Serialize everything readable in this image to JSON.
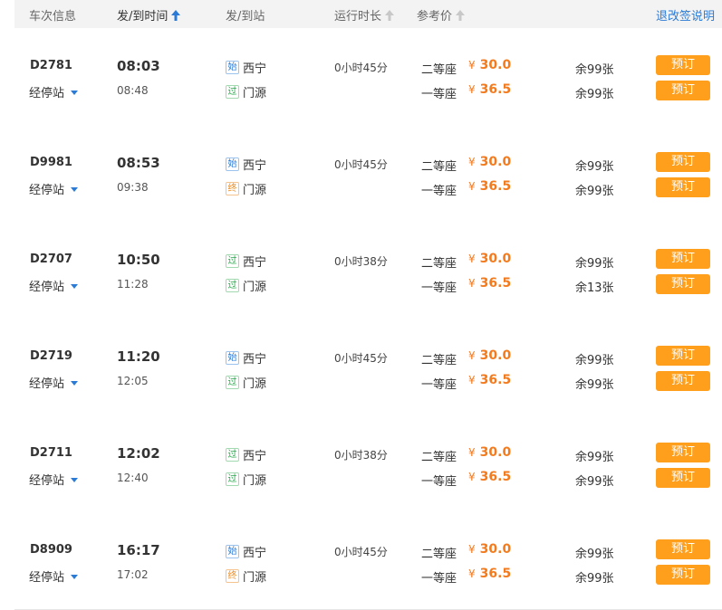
{
  "header": {
    "train_info": "车次信息",
    "dep_arr_time": "发/到时间",
    "dep_arr_station": "发/到站",
    "duration": "运行时长",
    "ref_price": "参考价",
    "rules_link": "退改签说明"
  },
  "colors": {
    "accent_blue": "#2b7bd6",
    "price_orange": "#f37b1d",
    "button_orange": "#ff9f1c"
  },
  "trains": [
    {
      "number": "D2781",
      "stops_label": "经停站",
      "dep_time": "08:03",
      "arr_time": "08:48",
      "from_tag": "始",
      "from_tag_type": "start",
      "from_station": "西宁",
      "to_tag": "过",
      "to_tag_type": "pass",
      "to_station": "门源",
      "duration": "0小时45分",
      "seat1_class": "二等座",
      "seat1_currency": "¥",
      "seat1_price": "30.0",
      "seat1_remain": "余99张",
      "seat2_class": "一等座",
      "seat2_currency": "¥",
      "seat2_price": "36.5",
      "seat2_remain": "余99张",
      "book_label": "预订"
    },
    {
      "number": "D9981",
      "stops_label": "经停站",
      "dep_time": "08:53",
      "arr_time": "09:38",
      "from_tag": "始",
      "from_tag_type": "start",
      "from_station": "西宁",
      "to_tag": "终",
      "to_tag_type": "end",
      "to_station": "门源",
      "duration": "0小时45分",
      "seat1_class": "二等座",
      "seat1_currency": "¥",
      "seat1_price": "30.0",
      "seat1_remain": "余99张",
      "seat2_class": "一等座",
      "seat2_currency": "¥",
      "seat2_price": "36.5",
      "seat2_remain": "余99张",
      "book_label": "预订"
    },
    {
      "number": "D2707",
      "stops_label": "经停站",
      "dep_time": "10:50",
      "arr_time": "11:28",
      "from_tag": "过",
      "from_tag_type": "pass",
      "from_station": "西宁",
      "to_tag": "过",
      "to_tag_type": "pass",
      "to_station": "门源",
      "duration": "0小时38分",
      "seat1_class": "二等座",
      "seat1_currency": "¥",
      "seat1_price": "30.0",
      "seat1_remain": "余99张",
      "seat2_class": "一等座",
      "seat2_currency": "¥",
      "seat2_price": "36.5",
      "seat2_remain": "余13张",
      "book_label": "预订"
    },
    {
      "number": "D2719",
      "stops_label": "经停站",
      "dep_time": "11:20",
      "arr_time": "12:05",
      "from_tag": "始",
      "from_tag_type": "start",
      "from_station": "西宁",
      "to_tag": "过",
      "to_tag_type": "pass",
      "to_station": "门源",
      "duration": "0小时45分",
      "seat1_class": "二等座",
      "seat1_currency": "¥",
      "seat1_price": "30.0",
      "seat1_remain": "余99张",
      "seat2_class": "一等座",
      "seat2_currency": "¥",
      "seat2_price": "36.5",
      "seat2_remain": "余99张",
      "book_label": "预订"
    },
    {
      "number": "D2711",
      "stops_label": "经停站",
      "dep_time": "12:02",
      "arr_time": "12:40",
      "from_tag": "过",
      "from_tag_type": "pass",
      "from_station": "西宁",
      "to_tag": "过",
      "to_tag_type": "pass",
      "to_station": "门源",
      "duration": "0小时38分",
      "seat1_class": "二等座",
      "seat1_currency": "¥",
      "seat1_price": "30.0",
      "seat1_remain": "余99张",
      "seat2_class": "一等座",
      "seat2_currency": "¥",
      "seat2_price": "36.5",
      "seat2_remain": "余99张",
      "book_label": "预订"
    },
    {
      "number": "D8909",
      "stops_label": "经停站",
      "dep_time": "16:17",
      "arr_time": "17:02",
      "from_tag": "始",
      "from_tag_type": "start",
      "from_station": "西宁",
      "to_tag": "终",
      "to_tag_type": "end",
      "to_station": "门源",
      "duration": "0小时45分",
      "seat1_class": "二等座",
      "seat1_currency": "¥",
      "seat1_price": "30.0",
      "seat1_remain": "余99张",
      "seat2_class": "一等座",
      "seat2_currency": "¥",
      "seat2_price": "36.5",
      "seat2_remain": "余99张",
      "book_label": "预订"
    }
  ]
}
